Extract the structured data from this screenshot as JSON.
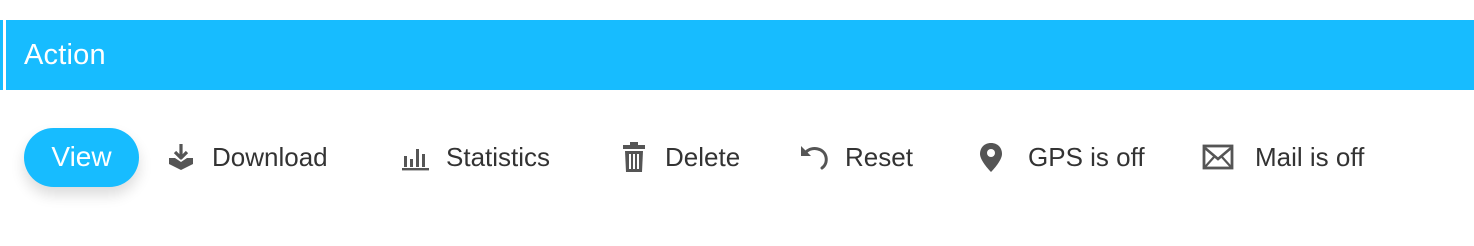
{
  "header": {
    "title": "Action",
    "color": "#17bcff"
  },
  "toolbar": {
    "view_label": "View",
    "actions": [
      {
        "label": "Download",
        "icon": "download-icon"
      },
      {
        "label": "Statistics",
        "icon": "bar-chart-icon"
      },
      {
        "label": "Delete",
        "icon": "trash-icon"
      },
      {
        "label": "Reset",
        "icon": "undo-icon"
      },
      {
        "label": "GPS is off",
        "icon": "map-pin-icon"
      },
      {
        "label": "Mail is off",
        "icon": "envelope-icon"
      }
    ]
  },
  "colors": {
    "accent": "#17bcff",
    "text": "#333333",
    "icon": "#555555"
  }
}
